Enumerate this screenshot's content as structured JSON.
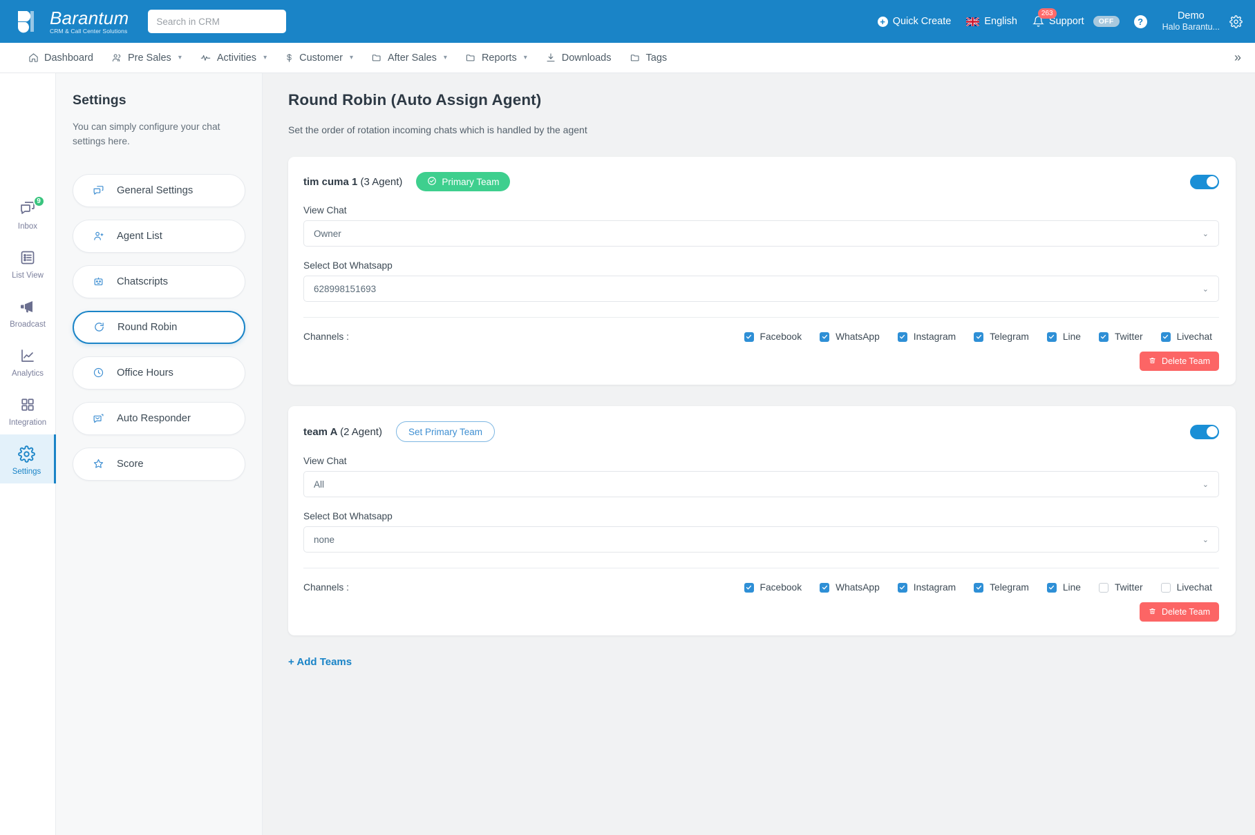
{
  "header": {
    "logo_name": "Barantum",
    "logo_tagline": "CRM & Call Center Solutions",
    "search_placeholder": "Search in CRM",
    "quick_create": "Quick Create",
    "language": "English",
    "notification_count": "263",
    "support": "Support",
    "support_state": "OFF",
    "user_name": "Demo",
    "user_org": "Halo Barantu...",
    "help_glyph": "?",
    "plus_glyph": "+"
  },
  "nav": {
    "items": [
      {
        "label": "Dashboard",
        "icon": "home-icon",
        "caret": false
      },
      {
        "label": "Pre Sales",
        "icon": "users-icon",
        "caret": true
      },
      {
        "label": "Activities",
        "icon": "activity-icon",
        "caret": true
      },
      {
        "label": "Customer",
        "icon": "dollar-icon",
        "caret": true
      },
      {
        "label": "After Sales",
        "icon": "folder-icon",
        "caret": true
      },
      {
        "label": "Reports",
        "icon": "folder-icon",
        "caret": true
      },
      {
        "label": "Downloads",
        "icon": "download-icon",
        "caret": false
      },
      {
        "label": "Tags",
        "icon": "folder-icon",
        "caret": false
      }
    ],
    "more_glyph": "»"
  },
  "rail": {
    "items": [
      {
        "label": "Inbox",
        "icon": "chat-icon",
        "badge": "9",
        "active": false
      },
      {
        "label": "List View",
        "icon": "list-icon",
        "badge": "",
        "active": false
      },
      {
        "label": "Broadcast",
        "icon": "megaphone-icon",
        "badge": "",
        "active": false
      },
      {
        "label": "Analytics",
        "icon": "chart-icon",
        "badge": "",
        "active": false
      },
      {
        "label": "Integration",
        "icon": "grid-icon",
        "badge": "",
        "active": false
      },
      {
        "label": "Settings",
        "icon": "gear-icon",
        "badge": "",
        "active": true
      }
    ]
  },
  "sidebar": {
    "title": "Settings",
    "description": "You can simply configure your chat settings here.",
    "items": [
      {
        "label": "General Settings",
        "icon": "chat-bubble-icon",
        "active": false
      },
      {
        "label": "Agent List",
        "icon": "agent-icon",
        "active": false
      },
      {
        "label": "Chatscripts",
        "icon": "robot-icon",
        "active": false
      },
      {
        "label": "Round Robin",
        "icon": "refresh-icon",
        "active": true
      },
      {
        "label": "Office Hours",
        "icon": "clock-icon",
        "active": false
      },
      {
        "label": "Auto Responder",
        "icon": "auto-reply-icon",
        "active": false
      },
      {
        "label": "Score",
        "icon": "star-icon",
        "active": false
      }
    ]
  },
  "main": {
    "page_title": "Round Robin (Auto Assign Agent)",
    "page_subtitle": "Set the order of rotation incoming chats which is handled by the agent",
    "labels": {
      "view_chat": "View Chat",
      "select_bot_whatsapp": "Select Bot Whatsapp",
      "channels": "Channels :",
      "delete_team": "Delete Team",
      "add_teams": "+ Add Teams",
      "primary_badge": "Primary Team",
      "set_primary": "Set Primary Team"
    },
    "teams": [
      {
        "name": "tim cuma 1",
        "agents": "(3 Agent)",
        "is_primary": true,
        "enabled": true,
        "view_chat": "Owner",
        "bot_whatsapp": "628998151693",
        "channels": [
          {
            "label": "Facebook",
            "checked": true
          },
          {
            "label": "WhatsApp",
            "checked": true
          },
          {
            "label": "Instagram",
            "checked": true
          },
          {
            "label": "Telegram",
            "checked": true
          },
          {
            "label": "Line",
            "checked": true
          },
          {
            "label": "Twitter",
            "checked": true
          },
          {
            "label": "Livechat",
            "checked": true
          }
        ]
      },
      {
        "name": "team A",
        "agents": "(2 Agent)",
        "is_primary": false,
        "enabled": true,
        "view_chat": "All",
        "bot_whatsapp": "none",
        "channels": [
          {
            "label": "Facebook",
            "checked": true
          },
          {
            "label": "WhatsApp",
            "checked": true
          },
          {
            "label": "Instagram",
            "checked": true
          },
          {
            "label": "Telegram",
            "checked": true
          },
          {
            "label": "Line",
            "checked": true
          },
          {
            "label": "Twitter",
            "checked": false
          },
          {
            "label": "Livechat",
            "checked": false
          }
        ]
      }
    ]
  },
  "colors": {
    "brand_blue": "#1a84c7",
    "green": "#3ecf8e",
    "red": "#fc6565"
  }
}
